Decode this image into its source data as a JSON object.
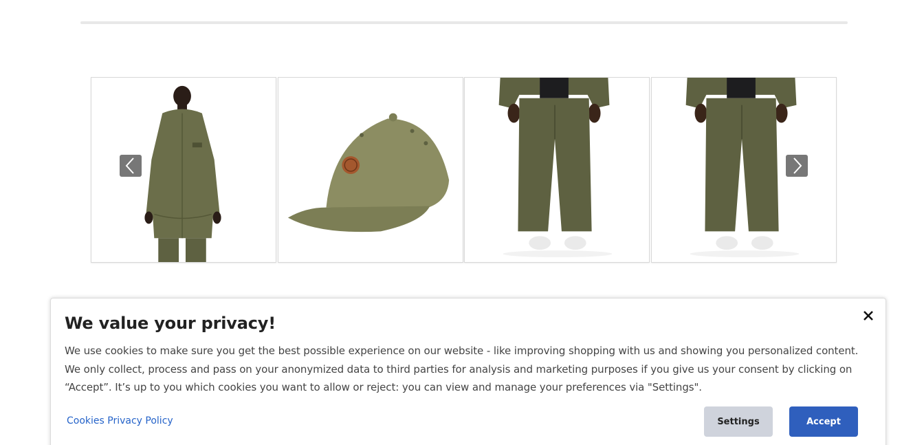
{
  "carousel": {
    "items": [
      {
        "icon": "parka-jacket-product-image"
      },
      {
        "icon": "cap-product-image"
      },
      {
        "icon": "corduroy-trousers-product-image"
      },
      {
        "icon": "corduroy-trousers-product-image"
      }
    ],
    "prev_icon": "chevron-left-icon",
    "next_icon": "chevron-right-icon"
  },
  "cookie_banner": {
    "title": "We value your privacy!",
    "body": "We use cookies to make sure you get the best possible experience on our website - like improving shopping with us and showing you personalized content. We only collect, process and pass on your anonymized data to third parties for analysis and marketing purposes if you give us your consent by clicking on “Accept”. It’s up to you which cookies you want to allow or reject: you can view and manage your preferences via \"Settings\".",
    "policy_link": "Cookies Privacy Policy",
    "settings_label": "Settings",
    "accept_label": "Accept",
    "close_icon": "close-icon"
  },
  "colors": {
    "accent": "#2f5fbd",
    "link": "#2563c9",
    "settings_bg": "#cfd3dc",
    "product_olive": "#6b6e4a"
  }
}
